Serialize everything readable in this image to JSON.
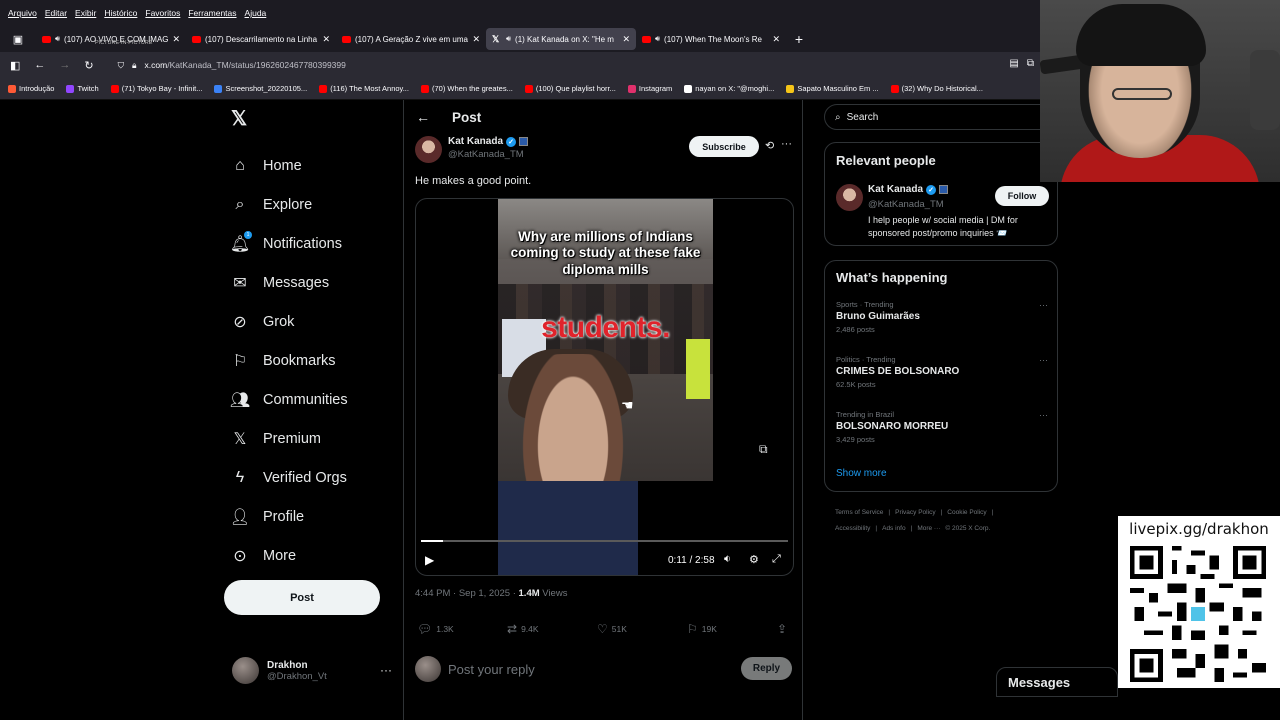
{
  "browser": {
    "menu": [
      "Arquivo",
      "Editar",
      "Exibir",
      "Histórico",
      "Favoritos",
      "Ferramentas",
      "Ajuda"
    ],
    "tabs": [
      {
        "title": "(107) AO VIVO E COM IMAG",
        "subtitle": "PICTURE-IN-PICTURE",
        "favicon": "youtube"
      },
      {
        "title": "(107) Descarrilamento na Linha",
        "favicon": "youtube"
      },
      {
        "title": "(107) A Geração Z vive em uma",
        "favicon": "youtube"
      },
      {
        "title": "(1) Kat Kanada on X: \"He m",
        "favicon": "x"
      },
      {
        "title": "(107) When The Moon's Re",
        "favicon": "youtube"
      }
    ],
    "url_host": "x.com",
    "url_path": "/KatKanada_TM/status/1962602467780399399",
    "bookmarks": [
      "Introdução",
      "Twitch",
      "(71) Tokyo Bay - Infinit...",
      "Screenshot_20220105...",
      "(116) The Most Annoy...",
      "(70) When the greates...",
      "(100) Que playlist horr...",
      "Instagram",
      "nayan on X: \"@moghi...",
      "Sapato Masculino Em ...",
      "(32) Why Do Historical..."
    ]
  },
  "sidebar": {
    "items": [
      {
        "label": "Home",
        "icon": "home-icon"
      },
      {
        "label": "Explore",
        "icon": "search-icon"
      },
      {
        "label": "Notifications",
        "icon": "bell-icon"
      },
      {
        "label": "Messages",
        "icon": "mail-icon"
      },
      {
        "label": "Grok",
        "icon": "grok-icon"
      },
      {
        "label": "Bookmarks",
        "icon": "bookmark-icon"
      },
      {
        "label": "Communities",
        "icon": "communities-icon"
      },
      {
        "label": "Premium",
        "icon": "x-icon"
      },
      {
        "label": "Verified Orgs",
        "icon": "lightning-icon"
      },
      {
        "label": "Profile",
        "icon": "person-icon"
      },
      {
        "label": "More",
        "icon": "more-circle-icon"
      }
    ],
    "notification_badge": "1",
    "post_label": "Post",
    "account": {
      "name": "Drakhon",
      "handle": "@Drakhon_Vt"
    }
  },
  "post": {
    "header": "Post",
    "author_name": "Kat Kanada",
    "author_handle": "@KatKanada_TM",
    "subscribe_label": "Subscribe",
    "text": "He makes a good point.",
    "video": {
      "caption": "Why are millions of Indians coming to study at these fake diploma mills",
      "overlay_word": "students.",
      "time": "0:11 / 2:58",
      "progress": 0.06
    },
    "timestamp": "4:44 PM · Sep 1, 2025 · ",
    "views_count": "1.4M",
    "views_label": " Views",
    "stats": {
      "replies": "1.3K",
      "reposts": "9.4K",
      "likes": "51K",
      "bookmarks": "19K"
    },
    "reply_placeholder": "Post your reply",
    "reply_label": "Reply"
  },
  "right": {
    "search_placeholder": "Search",
    "relevant": {
      "title": "Relevant people",
      "name": "Kat Kanada",
      "handle": "@KatKanada_TM",
      "bio": "I help people w/ social media | DM for sponsored post/promo inquiries 📨",
      "follow_label": "Follow"
    },
    "happening": {
      "title": "What’s happening",
      "trends": [
        {
          "category": "Sports · Trending",
          "name": "Bruno Guimarães",
          "count": "2,486 posts"
        },
        {
          "category": "Politics · Trending",
          "name": "CRIMES DE BOLSONARO",
          "count": "62.5K posts"
        },
        {
          "category": "Trending in Brazil",
          "name": "BOLSONARO MORREU",
          "count": "3,429 posts"
        }
      ],
      "show_more": "Show more"
    },
    "footer": [
      "Terms of Service",
      "|",
      "Privacy Policy",
      "|",
      "Cookie Policy",
      "|",
      "Accessibility",
      "|",
      "Ads info",
      "|",
      "More ···",
      "© 2025 X Corp."
    ]
  },
  "overlay": {
    "qr_title": "livepix.gg/drakhon",
    "messages_label": "Messages"
  }
}
